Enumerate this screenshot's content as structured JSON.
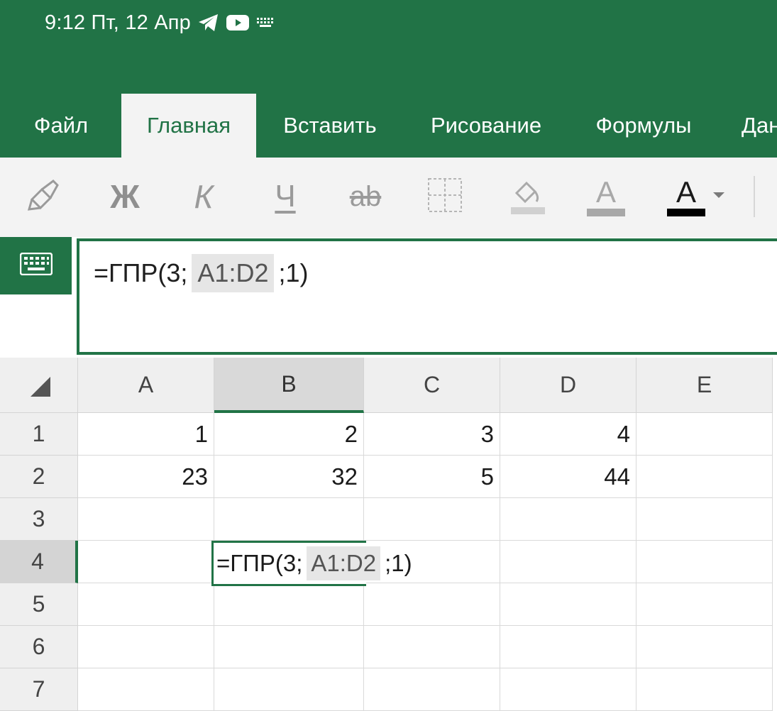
{
  "status_bar": {
    "time": "9:12 Пт, 12 Апр",
    "icons": [
      "telegram-icon",
      "youtube-icon",
      "keyboard-icon"
    ]
  },
  "tabs": [
    {
      "label": "Файл",
      "active": false
    },
    {
      "label": "Главная",
      "active": true
    },
    {
      "label": "Вставить",
      "active": false
    },
    {
      "label": "Рисование",
      "active": false
    },
    {
      "label": "Формулы",
      "active": false
    },
    {
      "label": "Дан",
      "active": false
    }
  ],
  "ribbon": {
    "bold_label": "Ж",
    "italic_label": "К",
    "underline_label": "Ч",
    "strike_label": "ab",
    "highlight_label": "A",
    "font_color_label": "A",
    "icons": [
      "format-painter-icon",
      "borders-icon",
      "fill-color-icon",
      "chevron-down-icon"
    ]
  },
  "formula_bar": {
    "prefix": "=ГПР(3;",
    "range": "A1:D2",
    "suffix": ";1)"
  },
  "grid": {
    "columns": [
      "A",
      "B",
      "C",
      "D",
      "E"
    ],
    "selected_column": "B",
    "rows": [
      "1",
      "2",
      "3",
      "4",
      "5",
      "6",
      "7"
    ],
    "selected_row": "4",
    "cells": {
      "r1": [
        "1",
        "2",
        "3",
        "4",
        ""
      ],
      "r2": [
        "23",
        "32",
        "5",
        "44",
        ""
      ]
    },
    "editing_cell": {
      "prefix": "=ГПР(3;",
      "range": "A1:D2",
      "suffix": ";1)"
    }
  },
  "colors": {
    "accent": "#217346",
    "ribbon_bg": "#f3f3f3",
    "header_bg": "#efefef",
    "range_highlight": "#e6e6e6"
  }
}
